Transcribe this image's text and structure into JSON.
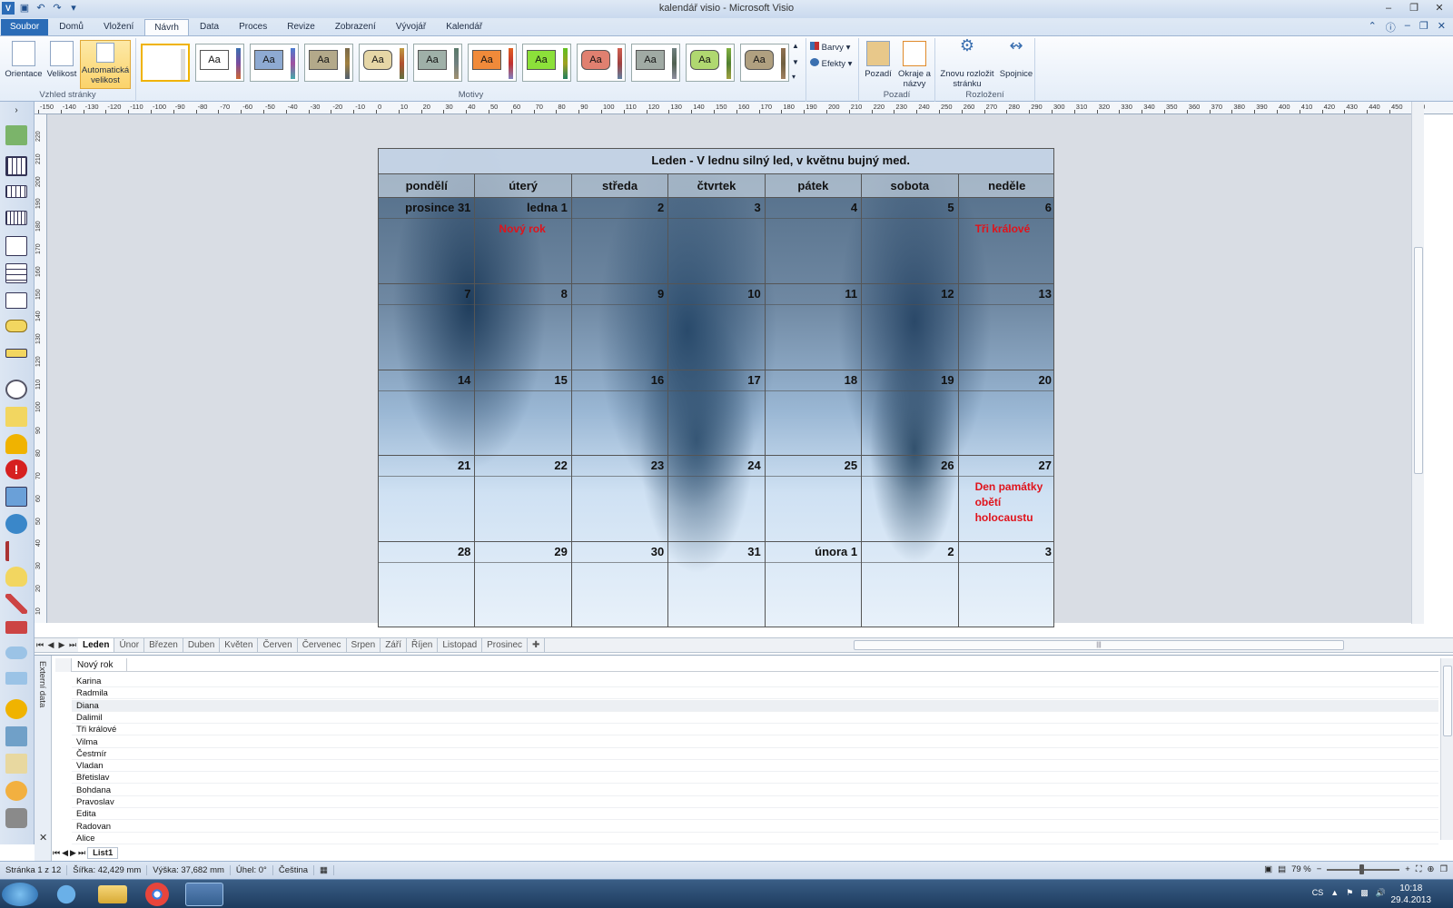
{
  "window": {
    "title": "kalendář visio - Microsoft Visio"
  },
  "ribbon": {
    "tabs": [
      "Soubor",
      "Domů",
      "Vložení",
      "Návrh",
      "Data",
      "Proces",
      "Revize",
      "Zobrazení",
      "Vývojář",
      "Kalendář"
    ],
    "active_tab": "Návrh",
    "page_setup": {
      "orientation": "Orientace",
      "size": "Velikost",
      "auto_size": "Automatická velikost",
      "group_label": "Vzhled stránky"
    },
    "themes": {
      "sample": "Aa",
      "group_label": "Motivy",
      "colors_label": "Barvy",
      "effects_label": "Efekty"
    },
    "backgrounds": {
      "background": "Pozadí",
      "borders_titles": "Okraje a názvy",
      "group_label": "Pozadí"
    },
    "layout": {
      "relayout": "Znovu rozložit stránku",
      "connectors": "Spojnice",
      "group_label": "Rozložení"
    }
  },
  "ruler": {
    "top_labels": [
      "-150",
      "-140",
      "-130",
      "-120",
      "-110",
      "-100",
      "-90",
      "-80",
      "-70",
      "-60",
      "-50",
      "-40",
      "-30",
      "-20",
      "-10",
      "0",
      "10",
      "20",
      "30",
      "40",
      "50",
      "60",
      "70",
      "80",
      "90",
      "100",
      "110",
      "120",
      "130",
      "140",
      "150",
      "160",
      "170",
      "180",
      "190",
      "200",
      "210",
      "220",
      "230",
      "240",
      "250",
      "260",
      "270",
      "280",
      "290",
      "300",
      "310",
      "320",
      "330",
      "340",
      "350",
      "360",
      "370",
      "380",
      "390",
      "400",
      "410",
      "420",
      "430",
      "440",
      "450",
      "460"
    ],
    "left_labels": [
      "220",
      "210",
      "200",
      "190",
      "180",
      "170",
      "160",
      "150",
      "140",
      "130",
      "120",
      "110",
      "100",
      "90",
      "80",
      "70",
      "60",
      "50",
      "40",
      "30",
      "20",
      "10"
    ]
  },
  "calendar": {
    "title": "Leden -  V lednu silný led, v květnu bujný med.",
    "weekdays": [
      "pondělí",
      "úterý",
      "středa",
      "čtvrtek",
      "pátek",
      "sobota",
      "neděle"
    ],
    "weeks": [
      [
        {
          "n": "prosince 31"
        },
        {
          "n": "ledna 1",
          "h": "Nový rok"
        },
        {
          "n": "2"
        },
        {
          "n": "3"
        },
        {
          "n": "4"
        },
        {
          "n": "5"
        },
        {
          "n": "6",
          "h": "Tři králové"
        }
      ],
      [
        {
          "n": "7"
        },
        {
          "n": "8"
        },
        {
          "n": "9"
        },
        {
          "n": "10"
        },
        {
          "n": "11"
        },
        {
          "n": "12"
        },
        {
          "n": "13"
        }
      ],
      [
        {
          "n": "14"
        },
        {
          "n": "15"
        },
        {
          "n": "16"
        },
        {
          "n": "17"
        },
        {
          "n": "18"
        },
        {
          "n": "19"
        },
        {
          "n": "20"
        }
      ],
      [
        {
          "n": "21"
        },
        {
          "n": "22"
        },
        {
          "n": "23"
        },
        {
          "n": "24"
        },
        {
          "n": "25"
        },
        {
          "n": "26"
        },
        {
          "n": "27",
          "h": "Den památky obětí holocaustu"
        }
      ],
      [
        {
          "n": "28"
        },
        {
          "n": "29"
        },
        {
          "n": "30"
        },
        {
          "n": "31"
        },
        {
          "n": "února 1"
        },
        {
          "n": "2"
        },
        {
          "n": "3"
        }
      ]
    ]
  },
  "page_tabs": {
    "tabs": [
      "Leden",
      "Únor",
      "Březen",
      "Duben",
      "Květen",
      "Červen",
      "Červenec",
      "Srpen",
      "Září",
      "Říjen",
      "Listopad",
      "Prosinec"
    ],
    "active": "Leden"
  },
  "external_data": {
    "panel_label": "Externí data",
    "column": "Nový rok",
    "rows": [
      "Karina",
      "Radmila",
      "Diana",
      "Dalimil",
      "Tři králové",
      "Vilma",
      "Čestmír",
      "Vladan",
      "Břetislav",
      "Bohdana",
      "Pravoslav",
      "Edita",
      "Radovan",
      "Alice"
    ],
    "sheet_tab": "List1"
  },
  "status": {
    "page": "Stránka 1 z 12",
    "width": "Šířka: 42,429 mm",
    "height": "Výška: 37,682 mm",
    "angle": "Úhel: 0°",
    "language": "Čeština",
    "zoom": "79 %"
  },
  "taskbar": {
    "lang": "CS",
    "time": "10:18",
    "date": "29.4.2013"
  },
  "colors": {
    "ribbon_file_tab": "#2b6cb7",
    "holiday": "#e0131b",
    "selected_theme": "#f0b300"
  }
}
